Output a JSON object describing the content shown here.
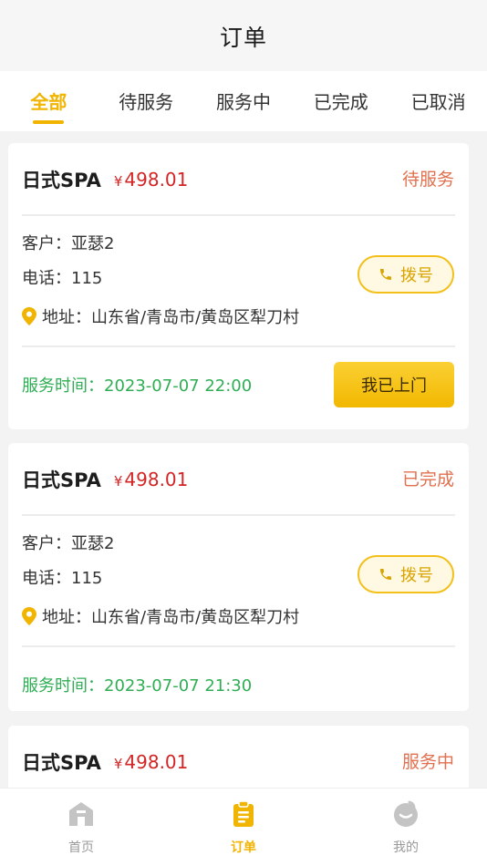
{
  "header": {
    "title": "订单"
  },
  "tabs": [
    {
      "label": "全部",
      "active": true
    },
    {
      "label": "待服务",
      "active": false
    },
    {
      "label": "服务中",
      "active": false
    },
    {
      "label": "已完成",
      "active": false
    },
    {
      "label": "已取消",
      "active": false
    }
  ],
  "orders": [
    {
      "service": "日式SPA",
      "currency": "¥",
      "price": "498.01",
      "status": "待服务",
      "customer": "客户：亚瑟2",
      "phone": "电话：115",
      "address": "地址：山东省/青岛市/黄岛区犁刀村",
      "dial_label": "拨号",
      "time": "服务时间：2023-07-07 22:00",
      "action_label": "我已上门"
    },
    {
      "service": "日式SPA",
      "currency": "¥",
      "price": "498.01",
      "status": "已完成",
      "customer": "客户：亚瑟2",
      "phone": "电话：115",
      "address": "地址：山东省/青岛市/黄岛区犁刀村",
      "dial_label": "拨号",
      "time": "服务时间：2023-07-07 21:30"
    },
    {
      "service": "日式SPA",
      "currency": "¥",
      "price": "498.01",
      "status": "服务中"
    }
  ],
  "bottom_nav": [
    {
      "label": "首页",
      "icon": "home-icon",
      "active": false
    },
    {
      "label": "订单",
      "icon": "order-icon",
      "active": true
    },
    {
      "label": "我的",
      "icon": "profile-icon",
      "active": false
    }
  ],
  "colors": {
    "accent": "#f1b400",
    "price": "#d32525",
    "status": "#e0704f",
    "time": "#2fae54"
  }
}
